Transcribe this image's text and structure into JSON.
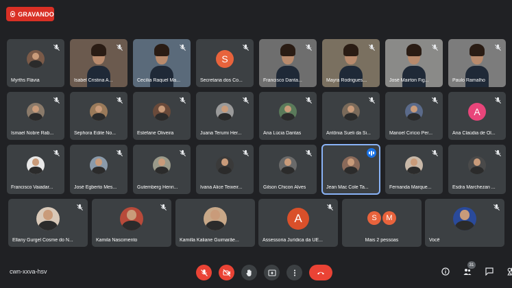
{
  "recording": {
    "label": "GRAVANDO"
  },
  "participants": [
    {
      "name": "Myrths Flávia",
      "kind": "avatar",
      "muted": true,
      "color": "#7a5a48"
    },
    {
      "name": "Isabel Cristina A...",
      "kind": "video",
      "muted": true,
      "color": "#6b5a4e"
    },
    {
      "name": "Cecília Raquel Ma...",
      "kind": "video",
      "muted": true,
      "color": "#5a6a7a"
    },
    {
      "name": "Secretaria dos Co...",
      "kind": "letter",
      "letter": "S",
      "muted": true,
      "color": "#e8633c"
    },
    {
      "name": "Francisco Danta...",
      "kind": "video",
      "muted": true,
      "color": "#6e6e6e"
    },
    {
      "name": "Mayra Rodrigues...",
      "kind": "video",
      "muted": true,
      "color": "#7a7060"
    },
    {
      "name": "José Mairton Fig...",
      "kind": "video",
      "muted": true,
      "color": "#8a8a88"
    },
    {
      "name": "Paulo Ramalho",
      "kind": "video",
      "muted": true,
      "color": "#7c7c7c"
    },
    {
      "name": "Ismael Nobre Rab...",
      "kind": "avatar",
      "muted": true,
      "color": "#8a7a6a"
    },
    {
      "name": "Sephora Edite No...",
      "kind": "avatar",
      "muted": true,
      "color": "#9a7a5a"
    },
    {
      "name": "Estefane Oliveira",
      "kind": "avatar",
      "muted": true,
      "color": "#6a4a3a"
    },
    {
      "name": "Juana Terumi Her...",
      "kind": "avatar",
      "muted": true,
      "color": "#9a9a9a"
    },
    {
      "name": "Ana Lúcia Dantas",
      "kind": "avatar",
      "muted": true,
      "color": "#5a7a5a"
    },
    {
      "name": "Antônia Sueli da Si...",
      "kind": "avatar",
      "muted": true,
      "color": "#7a6a5a"
    },
    {
      "name": "Manoel Cirício Per...",
      "kind": "avatar",
      "muted": true,
      "color": "#5a6a8a"
    },
    {
      "name": "Ana Claúdia de Ol...",
      "kind": "letter",
      "letter": "A",
      "muted": true,
      "color": "#e8457a"
    },
    {
      "name": "Francisco Vaiadar...",
      "kind": "avatar",
      "muted": true,
      "color": "#e8e8e8"
    },
    {
      "name": "José Egberto Mes...",
      "kind": "avatar",
      "muted": true,
      "color": "#8a9aaa"
    },
    {
      "name": "Gutemberg Henri...",
      "kind": "avatar",
      "muted": true,
      "color": "#9a9a8a"
    },
    {
      "name": "Ivana Alice Teixeir...",
      "kind": "avatar",
      "muted": true,
      "color": "#3a3a3a"
    },
    {
      "name": "Gilson Chicon Alves",
      "kind": "avatar",
      "muted": true,
      "color": "#6a6a6a"
    },
    {
      "name": "Jean Mac Cole Ta...",
      "kind": "avatar",
      "muted": false,
      "speaking": true,
      "color": "#8a6a5a"
    },
    {
      "name": "Fernanda Marque...",
      "kind": "avatar",
      "muted": true,
      "color": "#c8b8a8"
    },
    {
      "name": "Esdra Marchezan ...",
      "kind": "avatar",
      "muted": true,
      "color": "#4a4a4a"
    },
    {
      "name": "Ellany Gurgel Cosme do N...",
      "kind": "avatar",
      "muted": true,
      "color": "#d8c8b8"
    },
    {
      "name": "Kamila Nascimento",
      "kind": "avatar",
      "muted": true,
      "color": "#b84a3a"
    },
    {
      "name": "Kamilla Kaliane Guimarãe...",
      "kind": "avatar",
      "muted": false,
      "color": "#c8a888"
    },
    {
      "name": "Assessoria Jurídica da UE...",
      "kind": "letter",
      "letter": "A",
      "muted": true,
      "color": "#d9502a"
    },
    {
      "name": "Mais 2 pessoas",
      "kind": "more",
      "letters": [
        "S",
        "M"
      ],
      "muted": false,
      "color": "#e8633c"
    },
    {
      "name": "Você",
      "kind": "avatar",
      "muted": true,
      "color": "#2a4a9a"
    }
  ],
  "meeting": {
    "code": "cwn-xxva-hsv"
  },
  "controls": [
    {
      "name": "mic-off-button",
      "icon": "mic-off-icon",
      "style": "red"
    },
    {
      "name": "camera-off-button",
      "icon": "camera-off-icon",
      "style": "red"
    },
    {
      "name": "raise-hand-button",
      "icon": "hand-icon",
      "style": "gray"
    },
    {
      "name": "present-button",
      "icon": "present-icon",
      "style": "gray"
    },
    {
      "name": "more-options-button",
      "icon": "more-vert-icon",
      "style": "gray"
    },
    {
      "name": "leave-call-button",
      "icon": "hang-up-icon",
      "style": "hang"
    }
  ],
  "side": {
    "participants_count": "31"
  }
}
